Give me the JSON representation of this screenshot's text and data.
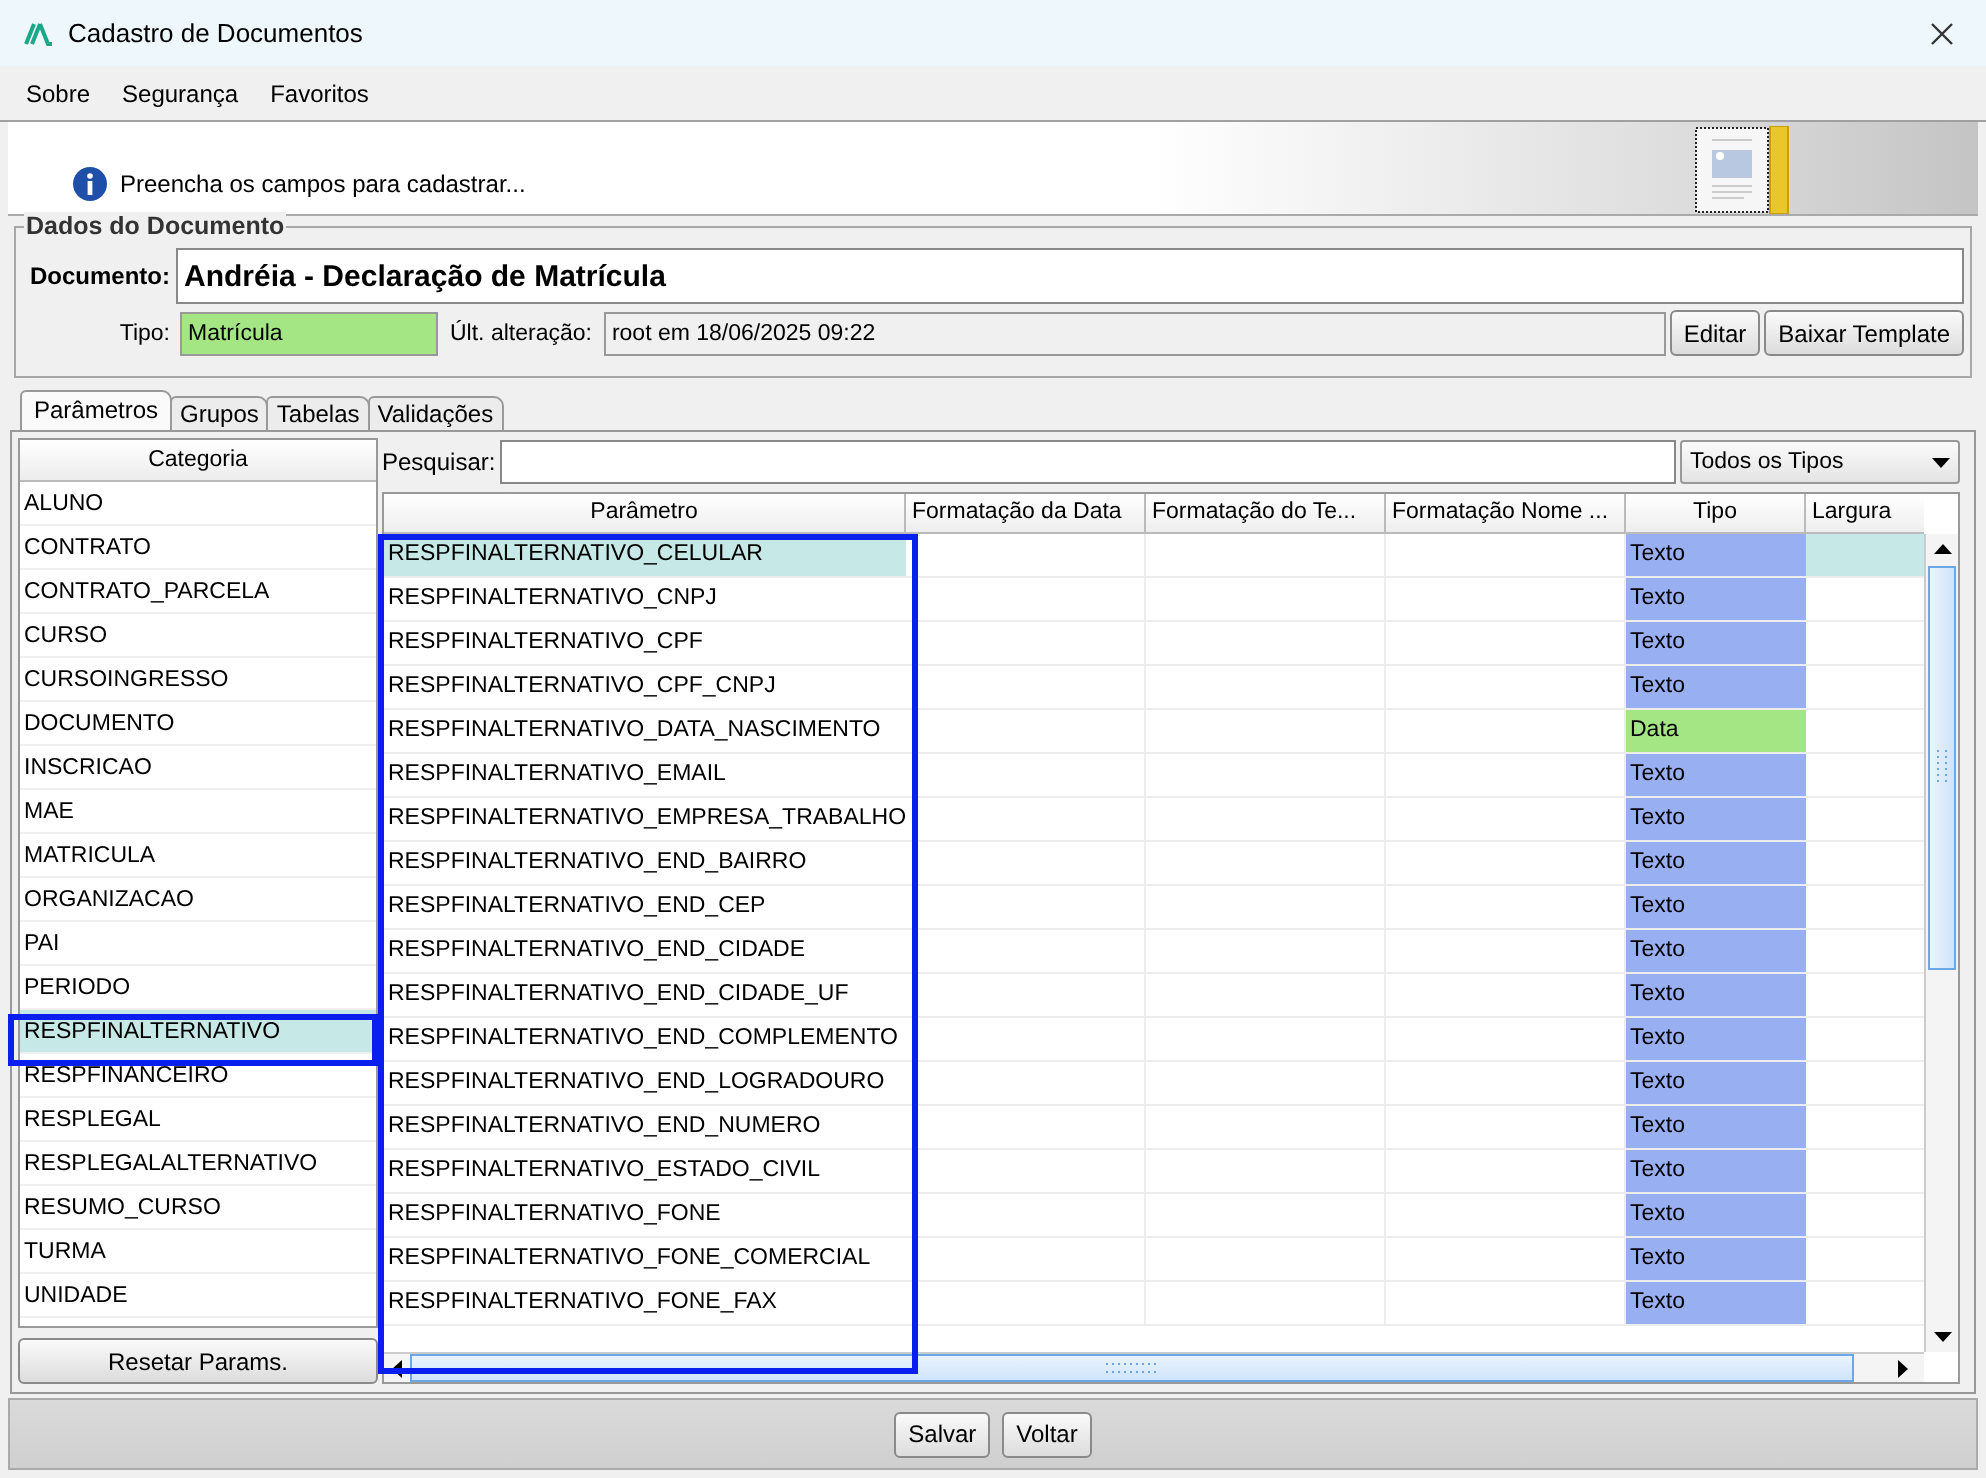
{
  "window": {
    "title": "Cadastro de Documentos"
  },
  "menu": [
    {
      "label": "Sobre"
    },
    {
      "label": "Segurança"
    },
    {
      "label": "Favoritos"
    }
  ],
  "info": {
    "message": "Preencha os campos para cadastrar..."
  },
  "document_group": {
    "title": "Dados do Documento",
    "document_label": "Documento:",
    "document_value": "Andréia - Declaração de Matrícula",
    "type_label": "Tipo:",
    "type_value": "Matrícula",
    "last_change_label": "Últ. alteração:",
    "last_change_value": "root em 18/06/2025 09:22",
    "buttons": [
      "Editar",
      "Baixar Template"
    ]
  },
  "tabs": [
    {
      "label": "Parâmetros",
      "selected": true
    },
    {
      "label": "Grupos",
      "selected": false
    },
    {
      "label": "Tabelas",
      "selected": false
    },
    {
      "label": "Validações",
      "selected": false
    }
  ],
  "categories": {
    "header": "Categoria",
    "items": [
      {
        "label": "ALUNO",
        "selected": false
      },
      {
        "label": "CONTRATO",
        "selected": false
      },
      {
        "label": "CONTRATO_PARCELA",
        "selected": false
      },
      {
        "label": "CURSO",
        "selected": false
      },
      {
        "label": "CURSOINGRESSO",
        "selected": false
      },
      {
        "label": "DOCUMENTO",
        "selected": false
      },
      {
        "label": "INSCRICAO",
        "selected": false
      },
      {
        "label": "MAE",
        "selected": false
      },
      {
        "label": "MATRICULA",
        "selected": false
      },
      {
        "label": "ORGANIZACAO",
        "selected": false
      },
      {
        "label": "PAI",
        "selected": false
      },
      {
        "label": "PERIODO",
        "selected": false
      },
      {
        "label": "RESPFINALTERNATIVO",
        "selected": true
      },
      {
        "label": "RESPFINANCEIRO",
        "selected": false
      },
      {
        "label": "RESPLEGAL",
        "selected": false
      },
      {
        "label": "RESPLEGALALTERNATIVO",
        "selected": false
      },
      {
        "label": "RESUMO_CURSO",
        "selected": false
      },
      {
        "label": "TURMA",
        "selected": false
      },
      {
        "label": "UNIDADE",
        "selected": false
      }
    ],
    "reset_button": "Resetar Params."
  },
  "search": {
    "label": "Pesquisar:"
  },
  "type_filter": {
    "value": "Todos os Tipos"
  },
  "table": {
    "columns": [
      "Parâmetro",
      "Formatação da Data",
      "Formatação do Te...",
      "Formatação Nome ...",
      "Tipo",
      "Largura"
    ],
    "rows": [
      {
        "parameter": "RESPFINALTERNATIVO_CELULAR",
        "type": "Texto",
        "color": "#98b0f2",
        "selected": true
      },
      {
        "parameter": "RESPFINALTERNATIVO_CNPJ",
        "type": "Texto",
        "color": "#98b0f2",
        "selected": false
      },
      {
        "parameter": "RESPFINALTERNATIVO_CPF",
        "type": "Texto",
        "color": "#98b0f2",
        "selected": false
      },
      {
        "parameter": "RESPFINALTERNATIVO_CPF_CNPJ",
        "type": "Texto",
        "color": "#98b0f2",
        "selected": false
      },
      {
        "parameter": "RESPFINALTERNATIVO_DATA_NASCIMENTO",
        "type": "Data",
        "color": "#a3e683",
        "selected": false
      },
      {
        "parameter": "RESPFINALTERNATIVO_EMAIL",
        "type": "Texto",
        "color": "#98b0f2",
        "selected": false
      },
      {
        "parameter": "RESPFINALTERNATIVO_EMPRESA_TRABALHO",
        "type": "Texto",
        "color": "#98b0f2",
        "selected": false
      },
      {
        "parameter": "RESPFINALTERNATIVO_END_BAIRRO",
        "type": "Texto",
        "color": "#98b0f2",
        "selected": false
      },
      {
        "parameter": "RESPFINALTERNATIVO_END_CEP",
        "type": "Texto",
        "color": "#98b0f2",
        "selected": false
      },
      {
        "parameter": "RESPFINALTERNATIVO_END_CIDADE",
        "type": "Texto",
        "color": "#98b0f2",
        "selected": false
      },
      {
        "parameter": "RESPFINALTERNATIVO_END_CIDADE_UF",
        "type": "Texto",
        "color": "#98b0f2",
        "selected": false
      },
      {
        "parameter": "RESPFINALTERNATIVO_END_COMPLEMENTO",
        "type": "Texto",
        "color": "#98b0f2",
        "selected": false
      },
      {
        "parameter": "RESPFINALTERNATIVO_END_LOGRADOURO",
        "type": "Texto",
        "color": "#98b0f2",
        "selected": false
      },
      {
        "parameter": "RESPFINALTERNATIVO_END_NUMERO",
        "type": "Texto",
        "color": "#98b0f2",
        "selected": false
      },
      {
        "parameter": "RESPFINALTERNATIVO_ESTADO_CIVIL",
        "type": "Texto",
        "color": "#98b0f2",
        "selected": false
      },
      {
        "parameter": "RESPFINALTERNATIVO_FONE",
        "type": "Texto",
        "color": "#98b0f2",
        "selected": false
      },
      {
        "parameter": "RESPFINALTERNATIVO_FONE_COMERCIAL",
        "type": "Texto",
        "color": "#98b0f2",
        "selected": false
      },
      {
        "parameter": "RESPFINALTERNATIVO_FONE_FAX",
        "type": "Texto",
        "color": "#98b0f2",
        "selected": false
      }
    ]
  },
  "buttons": [
    "Salvar",
    "Voltar"
  ]
}
